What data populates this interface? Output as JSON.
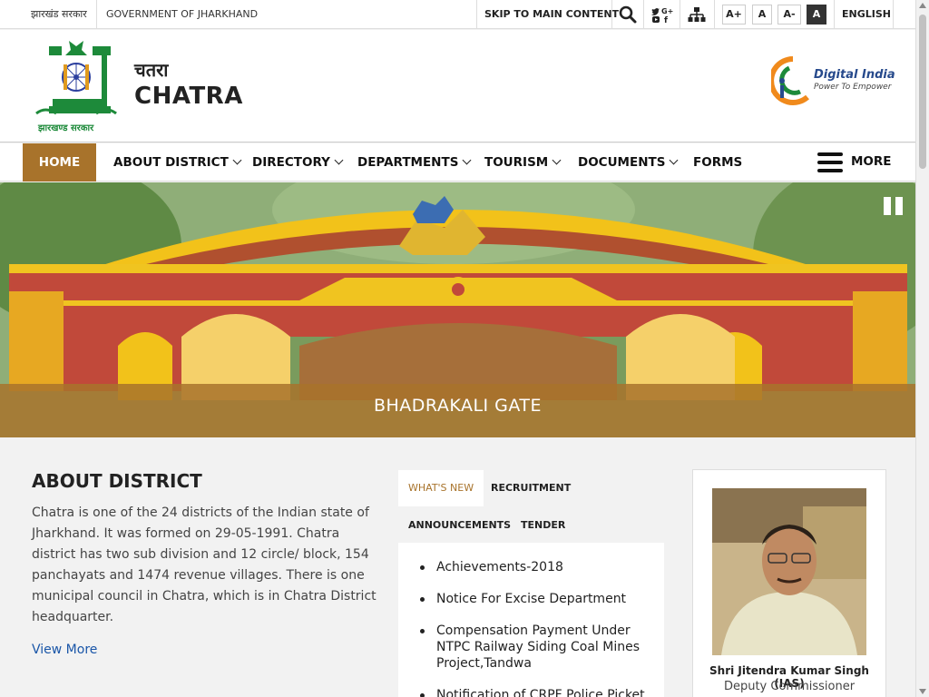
{
  "topbar": {
    "gov_hindi": "झारखंड सरकार",
    "gov_english": "GOVERNMENT OF JHARKHAND",
    "skip_label": "SKIP TO MAIN CONTENT",
    "font_buttons": [
      "A+",
      "A",
      "A-",
      "A"
    ],
    "language": "ENGLISH",
    "icons": [
      "search-icon",
      "social-icons",
      "sitemap-icon"
    ]
  },
  "header": {
    "site_title_hindi": "चतरा",
    "site_title": "CHATRA",
    "emblem_text": "झारखण्ड सरकार",
    "digital_india_title": "Digital India",
    "digital_india_sub": "Power To Empower"
  },
  "nav": {
    "items": [
      {
        "label": "HOME",
        "dropdown": false
      },
      {
        "label": "ABOUT DISTRICT",
        "dropdown": true
      },
      {
        "label": "DIRECTORY",
        "dropdown": true
      },
      {
        "label": "DEPARTMENTS",
        "dropdown": true
      },
      {
        "label": "TOURISM",
        "dropdown": true
      },
      {
        "label": "DOCUMENTS",
        "dropdown": true
      },
      {
        "label": "FORMS",
        "dropdown": false
      }
    ],
    "more_label": "MORE"
  },
  "slider": {
    "caption": "BHADRAKALI GATE"
  },
  "about": {
    "title": "ABOUT DISTRICT",
    "text": "Chatra is one of the 24 districts of the Indian state of Jharkhand. It was formed on 29-05-1991. Chatra district has two sub division and 12 circle/ block, 154 panchayats and 1474 revenue villages. There is one municipal council in Chatra, which is in Chatra District headquarter.",
    "view_more": "View More"
  },
  "tabs": {
    "labels": [
      "WHAT'S NEW",
      "RECRUITMENT",
      "ANNOUNCEMENTS",
      "TENDER"
    ],
    "items": [
      "Achievements-2018",
      "Notice For Excise Department",
      "Compensation Payment Under NTPC Railway Siding Coal Mines Project,Tandwa",
      "Notification of CRPF Police Picket"
    ]
  },
  "official": {
    "name": "Shri Jitendra Kumar Singh (IAS)",
    "role": "Deputy Commissioner"
  },
  "colors": {
    "accent": "#a8732b",
    "link": "#1a56a8",
    "emblem_green": "#1d8a3a"
  }
}
